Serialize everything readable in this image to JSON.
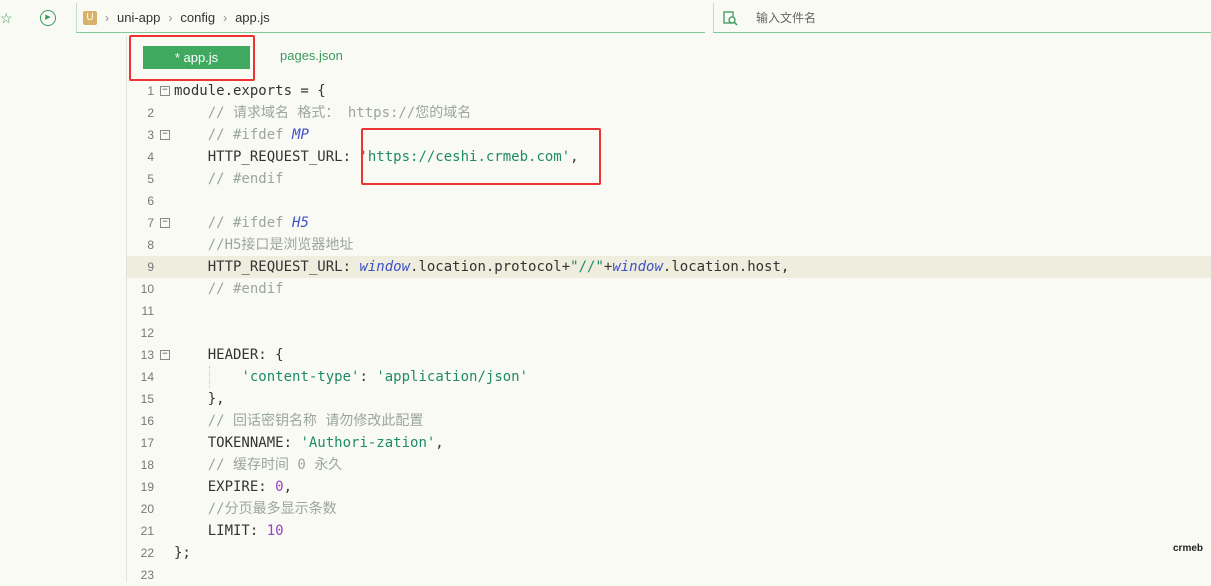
{
  "toolbar": {
    "star_icon": "☆",
    "run_icon": "▶"
  },
  "breadcrumb": {
    "logo": "U",
    "items": [
      "uni-app",
      "config",
      "app.js"
    ],
    "sep": "›"
  },
  "search": {
    "placeholder": "输入文件名"
  },
  "tabs": [
    {
      "label": "* app.js",
      "active": true
    },
    {
      "label": "pages.json",
      "active": false
    }
  ],
  "editor": {
    "current_line": 9,
    "lines": [
      {
        "n": "1",
        "fold": true,
        "parts": [
          [
            "pn",
            "module.exports = {"
          ]
        ]
      },
      {
        "n": "2",
        "fold": false,
        "parts": [
          [
            "pn",
            "    "
          ],
          [
            "cm",
            "// 请求域名 格式： https://您的域名"
          ]
        ]
      },
      {
        "n": "3",
        "fold": true,
        "parts": [
          [
            "pn",
            "    "
          ],
          [
            "cm",
            "// #ifdef "
          ],
          [
            "glb",
            "MP"
          ]
        ]
      },
      {
        "n": "4",
        "fold": false,
        "parts": [
          [
            "pn",
            "    HTTP_REQUEST_URL: "
          ],
          [
            "str",
            "'https://ceshi.crmeb.com'"
          ],
          [
            "pn",
            ","
          ]
        ]
      },
      {
        "n": "5",
        "fold": false,
        "parts": [
          [
            "pn",
            "    "
          ],
          [
            "cm",
            "// #endif"
          ]
        ]
      },
      {
        "n": "6",
        "fold": false,
        "parts": []
      },
      {
        "n": "7",
        "fold": true,
        "parts": [
          [
            "pn",
            "    "
          ],
          [
            "cm",
            "// #ifdef "
          ],
          [
            "glb",
            "H5"
          ]
        ]
      },
      {
        "n": "8",
        "fold": false,
        "parts": [
          [
            "pn",
            "    "
          ],
          [
            "cm",
            "//H5接口是浏览器地址"
          ]
        ]
      },
      {
        "n": "9",
        "fold": false,
        "parts": [
          [
            "pn",
            "    HTTP_REQUEST_URL: "
          ],
          [
            "glb",
            "window"
          ],
          [
            "pn",
            ".location.protocol+"
          ],
          [
            "str",
            "\"//\""
          ],
          [
            "pn",
            "+"
          ],
          [
            "glb",
            "window"
          ],
          [
            "pn",
            ".location.host,"
          ]
        ]
      },
      {
        "n": "10",
        "fold": false,
        "parts": [
          [
            "pn",
            "    "
          ],
          [
            "cm",
            "// #endif"
          ]
        ]
      },
      {
        "n": "11",
        "fold": false,
        "parts": []
      },
      {
        "n": "12",
        "fold": false,
        "parts": []
      },
      {
        "n": "13",
        "fold": true,
        "parts": [
          [
            "pn",
            "    HEADER: {"
          ]
        ]
      },
      {
        "n": "14",
        "fold": false,
        "parts": [
          [
            "pn",
            "        "
          ],
          [
            "str",
            "'content-type'"
          ],
          [
            "pn",
            ": "
          ],
          [
            "str",
            "'application/json'"
          ]
        ]
      },
      {
        "n": "15",
        "fold": false,
        "parts": [
          [
            "pn",
            "    },"
          ]
        ]
      },
      {
        "n": "16",
        "fold": false,
        "parts": [
          [
            "pn",
            "    "
          ],
          [
            "cm",
            "// 回话密钥名称 请勿修改此配置"
          ]
        ]
      },
      {
        "n": "17",
        "fold": false,
        "parts": [
          [
            "pn",
            "    TOKENNAME: "
          ],
          [
            "str",
            "'Authori-zation'"
          ],
          [
            "pn",
            ","
          ]
        ]
      },
      {
        "n": "18",
        "fold": false,
        "parts": [
          [
            "pn",
            "    "
          ],
          [
            "cm",
            "// 缓存时间 0 永久"
          ]
        ]
      },
      {
        "n": "19",
        "fold": false,
        "parts": [
          [
            "pn",
            "    EXPIRE: "
          ],
          [
            "num",
            "0"
          ],
          [
            "pn",
            ","
          ]
        ]
      },
      {
        "n": "20",
        "fold": false,
        "parts": [
          [
            "pn",
            "    "
          ],
          [
            "cm",
            "//分页最多显示条数"
          ]
        ]
      },
      {
        "n": "21",
        "fold": false,
        "parts": [
          [
            "pn",
            "    LIMIT: "
          ],
          [
            "num",
            "10"
          ]
        ]
      },
      {
        "n": "22",
        "fold": false,
        "parts": [
          [
            "pn",
            "};"
          ]
        ]
      },
      {
        "n": "23",
        "fold": false,
        "parts": []
      }
    ]
  },
  "watermark": "crmeb",
  "colors": {
    "accent": "#3faa5f",
    "highlight": "#ee3333"
  }
}
